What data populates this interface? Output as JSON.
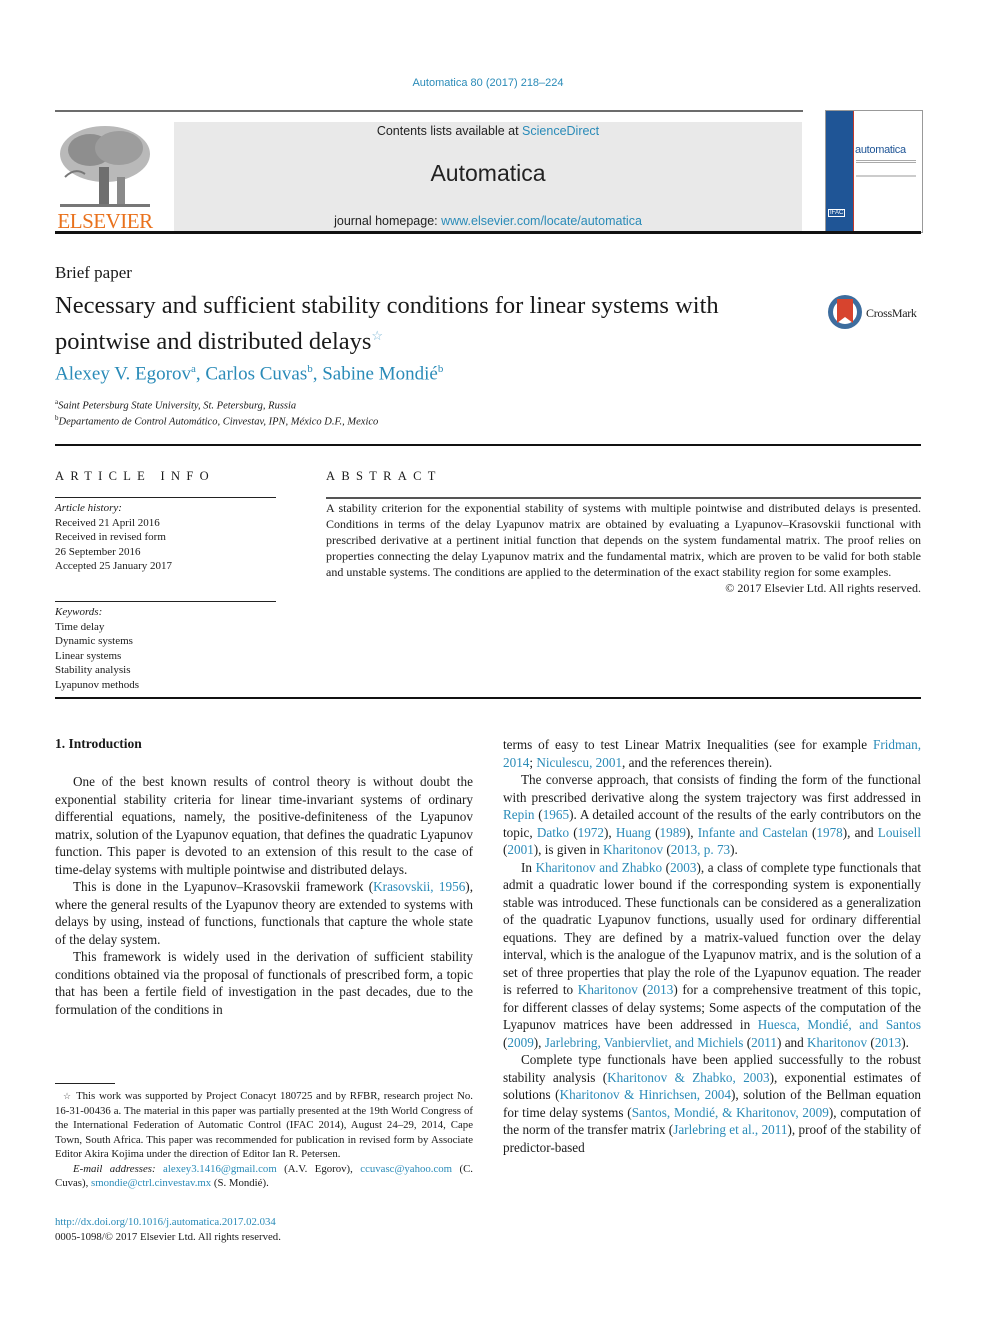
{
  "header": {
    "citation": "Automatica 80 (2017) 218–224",
    "contents_prefix": "Contents lists available at ",
    "contents_link": "ScienceDirect",
    "journal_name": "Automatica",
    "homepage_prefix": "journal homepage: ",
    "homepage_link": "www.elsevier.com/locate/automatica",
    "publisher_logo_text": "ELSEVIER",
    "cover_title": "automatica",
    "cover_badge": "IFAC",
    "brand_color": "#e9711c",
    "link_color": "#2a8bb8"
  },
  "article": {
    "type": "Brief paper",
    "title_line1": "Necessary and sufficient stability conditions for linear systems with",
    "title_line2": "pointwise and distributed delays",
    "title_mark": "☆",
    "crossmark_label": "CrossMark",
    "authors": [
      {
        "name": "Alexey V. Egorov",
        "sup": "a"
      },
      {
        "name": "Carlos Cuvas",
        "sup": "b"
      },
      {
        "name": "Sabine Mondié",
        "sup": "b"
      }
    ],
    "affiliations": [
      {
        "sup": "a",
        "text": "Saint Petersburg State University, St. Petersburg, Russia"
      },
      {
        "sup": "b",
        "text": "Departamento de Control Automático, Cinvestav, IPN, México D.F., Mexico"
      }
    ]
  },
  "article_info": {
    "heading": "ARTICLE INFO",
    "history_label": "Article history:",
    "history": [
      "Received 21 April 2016",
      "Received in revised form",
      "26 September 2016",
      "Accepted 25 January 2017"
    ],
    "keywords_label": "Keywords:",
    "keywords": [
      "Time delay",
      "Dynamic systems",
      "Linear systems",
      "Stability analysis",
      "Lyapunov methods"
    ]
  },
  "abstract": {
    "heading": "ABSTRACT",
    "text": "A stability criterion for the exponential stability of systems with multiple pointwise and distributed delays is presented. Conditions in terms of the delay Lyapunov matrix are obtained by evaluating a Lyapunov–Krasovskii functional with prescribed derivative at a pertinent initial function that depends on the system fundamental matrix. The proof relies on properties connecting the delay Lyapunov matrix and the fundamental matrix, which are proven to be valid for both stable and unstable systems. The conditions are applied to the determination of the exact stability region for some examples.",
    "copyright": "© 2017 Elsevier Ltd. All rights reserved."
  },
  "intro": {
    "title": "1.  Introduction",
    "p1": "One of the best known results of control theory is without doubt the exponential stability criteria for linear time-invariant systems of ordinary differential equations, namely, the positive-definiteness of the Lyapunov matrix, solution of the Lyapunov equation, that defines the quadratic Lyapunov function. This paper is devoted to an extension of this result to the case of time-delay systems with multiple pointwise and distributed delays.",
    "p2_a": "This is done in the Lyapunov–Krasovskii framework (",
    "p2_link": "Krasovskii, 1956",
    "p2_b": "), where the general results of the Lyapunov theory are extended to systems with delays by using, instead of functions, functionals that capture the whole state of the delay system.",
    "p3": "This framework is widely used in the derivation of sufficient stability conditions obtained via the proposal of functionals of prescribed form, a topic that has been a fertile field of investigation in the past decades, due to the formulation of the conditions in",
    "r1_a": "terms of easy to test Linear Matrix Inequalities (see for example ",
    "r1_l1": "Fridman, 2014",
    "r1_b": "; ",
    "r1_l2": "Niculescu, 2001",
    "r1_c": ", and the references therein).",
    "r2_a": "The converse approach, that consists of finding the form of the functional with prescribed derivative along the system trajectory was first addressed in ",
    "r2_l1": "Repin",
    "r2_b": " (",
    "r2_l1y": "1965",
    "r2_c": "). A detailed account of the results of the early contributors on the topic, ",
    "r2_l2": "Datko",
    "r2_d": " (",
    "r2_l2y": "1972",
    "r2_e": "), ",
    "r2_l3": "Huang",
    "r2_f": " (",
    "r2_l3y": "1989",
    "r2_g": "), ",
    "r2_l4": "Infante and Castelan",
    "r2_h": " (",
    "r2_l4y": "1978",
    "r2_i": "), and ",
    "r2_l5": "Louisell",
    "r2_j": " (",
    "r2_l5y": "2001",
    "r2_k": "), is given in ",
    "r2_l6": "Kharitonov",
    "r2_l": " (",
    "r2_l6y": "2013, p. 73",
    "r2_m": ").",
    "r3_a": "In ",
    "r3_l1": "Kharitonov and Zhabko",
    "r3_b": " (",
    "r3_l1y": "2003",
    "r3_c": "), a class of complete type functionals that admit a quadratic lower bound if the corresponding system is exponentially stable was introduced. These functionals can be considered as a generalization of the quadratic Lyapunov functions, usually used for ordinary differential equations. They are defined by a matrix-valued function over the delay interval, which is the analogue of the Lyapunov matrix, and is the solution of a set of three properties that play the role of the Lyapunov equation. The reader is referred to ",
    "r3_l2": "Kharitonov",
    "r3_d": " (",
    "r3_l2y": "2013",
    "r3_e": ") for a comprehensive treatment of this topic, for different classes of delay systems; Some aspects of the computation of the Lyapunov matrices have been addressed in ",
    "r3_l3": "Huesca, Mondié, and Santos",
    "r3_f": " (",
    "r3_l3y": "2009",
    "r3_g": "), ",
    "r3_l4": "Jarlebring, Vanbiervliet, and Michiels",
    "r3_h": " (",
    "r3_l4y": "2011",
    "r3_i": ") and ",
    "r3_l5": "Kharitonov",
    "r3_j": " (",
    "r3_l5y": "2013",
    "r3_k": ").",
    "r4_a": "Complete type functionals have been applied successfully to the robust stability analysis (",
    "r4_l1": "Kharitonov & Zhabko, 2003",
    "r4_b": "), exponential estimates of solutions (",
    "r4_l2": "Kharitonov & Hinrichsen, 2004",
    "r4_c": "), solution of the Bellman equation for time delay systems (",
    "r4_l3": "Santos, Mondié, & Kharitonov, 2009",
    "r4_d": "), computation of the norm of the transfer matrix (",
    "r4_l4": "Jarlebring et al., 2011",
    "r4_e": "), proof of the stability of predictor-based"
  },
  "footnote": {
    "star": "☆",
    "text": "This work was supported by Project Conacyt 180725 and by RFBR, research project No. 16-31-00436 a. The material in this paper was partially presented at the 19th World Congress of the International Federation of Automatic Control (IFAC 2014), August 24–29, 2014, Cape Town, South Africa. This paper was recommended for publication in revised form by Associate Editor Akira Kojima under the direction of Editor Ian R. Petersen.",
    "email_label": "E-mail addresses:",
    "emails": [
      {
        "addr": "alexey3.1416@gmail.com",
        "who": " (A.V. Egorov), "
      },
      {
        "addr": "ccuvasc@yahoo.com",
        "who": " (C. Cuvas), "
      },
      {
        "addr": "smondie@ctrl.cinvestav.mx",
        "who": " (S. Mondié)."
      }
    ],
    "doi": "http://dx.doi.org/10.1016/j.automatica.2017.02.034",
    "issn": "0005-1098/© 2017 Elsevier Ltd. All rights reserved."
  }
}
